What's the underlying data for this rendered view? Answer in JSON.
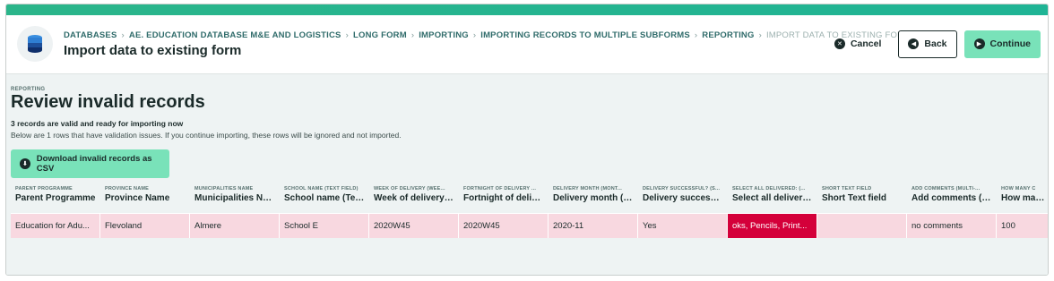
{
  "header": {
    "breadcrumb": [
      "DATABASES",
      "AE. EDUCATION DATABASE M&E AND LOGISTICS",
      "LONG FORM",
      "IMPORTING",
      "IMPORTING RECORDS TO MULTIPLE SUBFORMS",
      "REPORTING",
      "IMPORT DATA TO EXISTING FORM"
    ],
    "title": "Import data to existing form",
    "cancel_label": "Cancel",
    "back_label": "Back",
    "continue_label": "Continue"
  },
  "content": {
    "section_label": "REPORTING",
    "title": "Review invalid records",
    "valid_message": "3 records are valid and ready for importing now",
    "issue_message": "Below are 1 rows that have validation issues. If you continue importing, these rows will be ignored and not imported.",
    "download_label": "Download invalid records as CSV"
  },
  "table": {
    "columns": [
      {
        "small": "PARENT PROGRAMME",
        "big": "Parent Programme"
      },
      {
        "small": "PROVINCE NAME",
        "big": "Province Name"
      },
      {
        "small": "MUNICIPALITIES NAME",
        "big": "Municipalities Name"
      },
      {
        "small": "SCHOOL NAME (TEXT FIELD)",
        "big": "School name (Text ..."
      },
      {
        "small": "WEEK OF DELIVERY (WEE...",
        "big": "Week of delivery (..."
      },
      {
        "small": "FORTNIGHT OF DELIVERY ...",
        "big": "Fortnight of deliver..."
      },
      {
        "small": "DELIVERY MONTH (MONT...",
        "big": "Delivery month (M..."
      },
      {
        "small": "DELIVERY SUCCESSFUL? (S...",
        "big": "Delivery successful..."
      },
      {
        "small": "SELECT ALL DELIVERED: (...",
        "big": "Select all delivered:..."
      },
      {
        "small": "SHORT TEXT FIELD",
        "big": "Short Text field"
      },
      {
        "small": "ADD COMMENTS (MULTI-...",
        "big": "Add comments (Mu..."
      },
      {
        "small": "HOW MANY C",
        "big": "How many"
      }
    ],
    "rows": [
      [
        "Education for Adu...",
        "Flevoland",
        "Almere",
        "School E",
        "2020W45",
        "2020W45",
        "2020-11",
        "Yes",
        "oks, Pencils, Print...",
        "",
        "no comments",
        "100"
      ]
    ],
    "invalid_cell_color": "#d4003a",
    "invalid_row_color": "#f8d8e0"
  }
}
